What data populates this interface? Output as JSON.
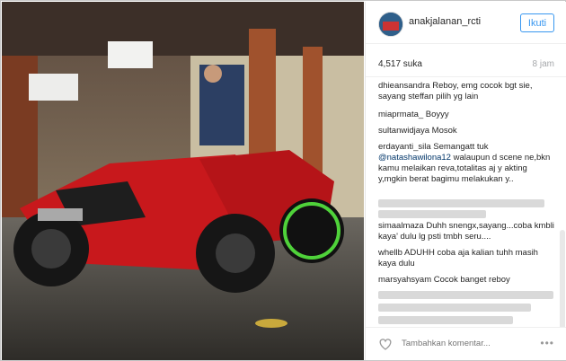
{
  "post": {
    "username": "anakjalanan_rcti",
    "follow_label": "Ikuti",
    "likes": "4,517 suka",
    "time": "8 jam",
    "comments": [
      {
        "user": "dhieansandra",
        "text": " Reboy, emg cocok bgt sie, sayang steffan pilih yg lain"
      },
      {
        "user": "miaprmata_",
        "text": " Boyyy"
      },
      {
        "user": "sultanwidjaya",
        "text": " Mosok"
      },
      {
        "user": "erdayanti_sila",
        "text": " Semangatt tuk ",
        "mention": "@natashawilona12",
        "text2": " walaupun d scene ne,bkn kamu melaikan reva,totalitas aj y akting y,mgkin berat bagimu melakukan y.."
      },
      {
        "user": "simaalmaza",
        "text": " Duhh snengx,sayang...coba kmbli kaya' dulu lg psti tmbh seru...."
      },
      {
        "user": "whellb",
        "text": " ADUHH coba aja kalian tuhh masih kaya dulu"
      },
      {
        "user": "marsyahsyam",
        "text": " Cocok banget reboy"
      }
    ],
    "add_comment_placeholder": "Tambahkan komentar...",
    "more_label": "•••"
  },
  "icons": {
    "heart": "heart-icon",
    "more": "more-options-icon"
  }
}
